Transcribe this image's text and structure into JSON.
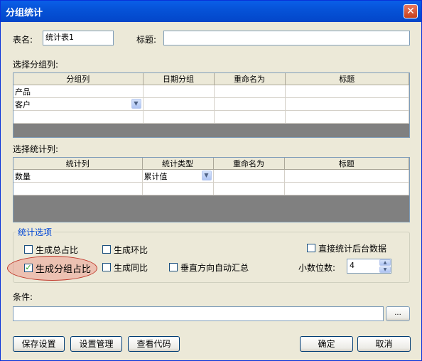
{
  "window": {
    "title": "分组统计",
    "close_glyph": "✕"
  },
  "form": {
    "table_name_label": "表名:",
    "table_name_value": "统计表1",
    "title_label": "标题:",
    "title_value": ""
  },
  "group_section": {
    "label": "选择分组列:",
    "columns": [
      "分组列",
      "日期分组",
      "重命名为",
      "标题"
    ],
    "rows": [
      [
        "产品",
        "",
        "",
        ""
      ],
      [
        "客户",
        "",
        "",
        ""
      ],
      [
        "",
        "",
        "",
        ""
      ]
    ]
  },
  "stat_section": {
    "label": "选择统计列:",
    "columns": [
      "统计列",
      "统计类型",
      "重命名为",
      "标题"
    ],
    "rows": [
      [
        "数量",
        "累计值",
        "",
        ""
      ],
      [
        "",
        "",
        "",
        ""
      ]
    ]
  },
  "options": {
    "legend": "统计选项",
    "total_ratio": {
      "label": "生成总占比",
      "checked": false
    },
    "ring_ratio": {
      "label": "生成环比",
      "checked": false
    },
    "direct_backend": {
      "label": "直接统计后台数据",
      "checked": false
    },
    "group_ratio": {
      "label": "生成分组占比",
      "checked": true
    },
    "yoy_ratio": {
      "label": "生成同比",
      "checked": false
    },
    "vertical_summary": {
      "label": "垂直方向自动汇总",
      "checked": false
    },
    "decimal_label": "小数位数:",
    "decimal_value": "4"
  },
  "condition": {
    "label": "条件:",
    "value": "",
    "browse_label": "..."
  },
  "buttons": {
    "save": "保存设置",
    "manage": "设置管理",
    "view_code": "查看代码",
    "ok": "确定",
    "cancel": "取消"
  },
  "colors": {
    "title_bar": "#0a5fe8",
    "legend": "#0046d5",
    "highlight": "#e57368"
  }
}
